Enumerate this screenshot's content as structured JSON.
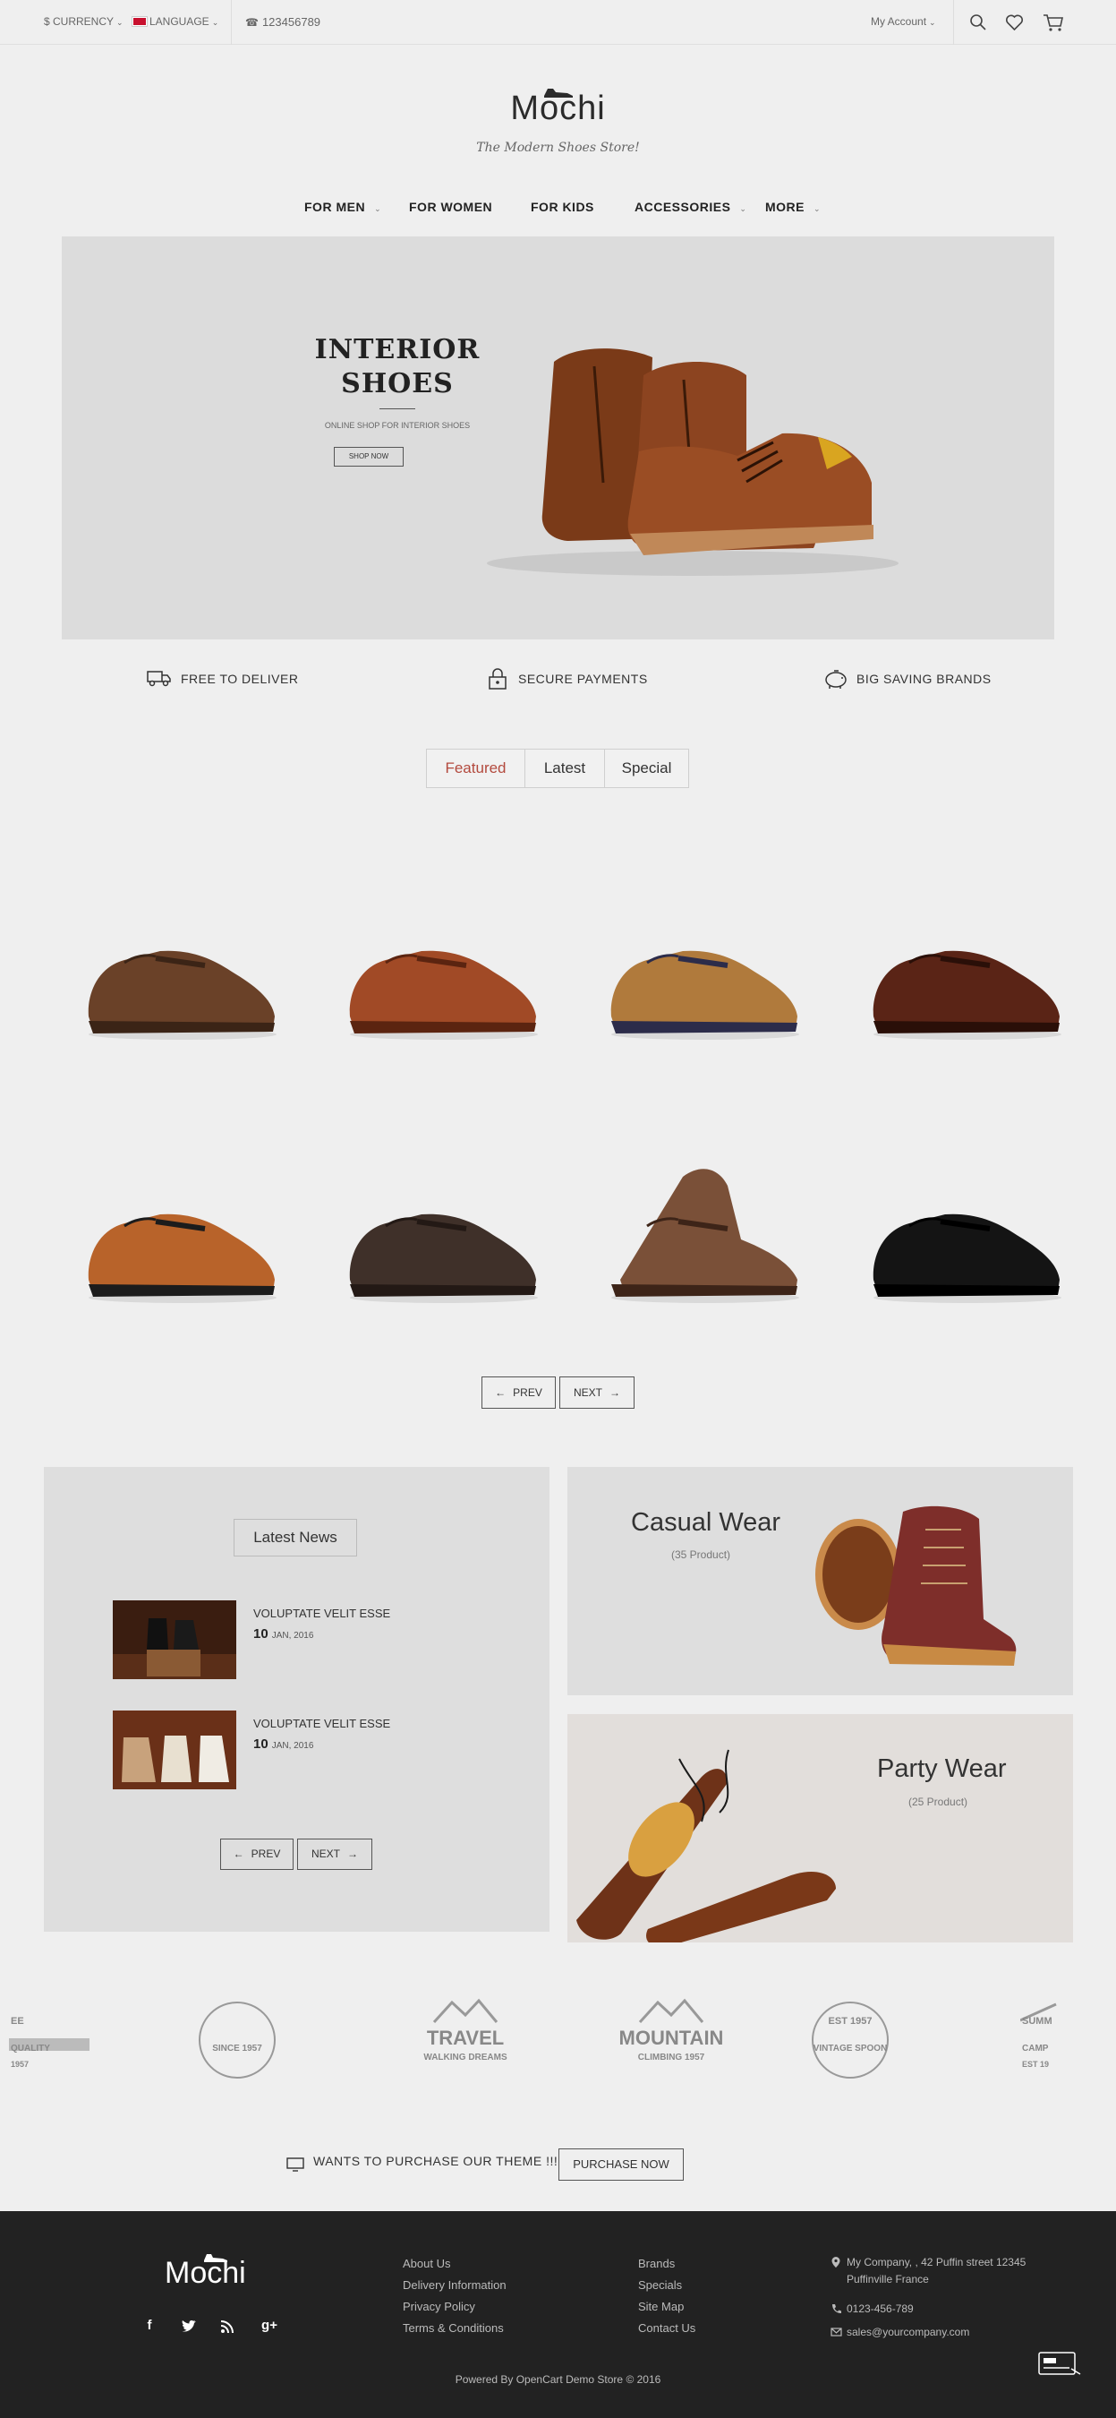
{
  "topbar": {
    "currency": "$ Currency",
    "language": "Language",
    "phone": "123456789",
    "account": "My Account"
  },
  "brand": {
    "name": "Mochi",
    "tagline": "The Modern Shoes Store!"
  },
  "nav": [
    {
      "label": "For Men",
      "has_dropdown": true
    },
    {
      "label": "For Women",
      "has_dropdown": false
    },
    {
      "label": "For Kids",
      "has_dropdown": false
    },
    {
      "label": "Accessories",
      "has_dropdown": true
    },
    {
      "label": "More",
      "has_dropdown": true
    }
  ],
  "banner": {
    "title_line1": "INTERIOR",
    "title_line2": "SHOES",
    "subtitle": "Online shop for interior shoes",
    "button": "Shop Now"
  },
  "features": [
    {
      "label": "Free to Deliver",
      "icon": "truck-icon"
    },
    {
      "label": "Secure Payments",
      "icon": "lock-icon"
    },
    {
      "label": "Big Saving Brands",
      "icon": "piggy-bank-icon"
    }
  ],
  "tabs": [
    {
      "label": "Featured",
      "active": true
    },
    {
      "label": "Latest",
      "active": false
    },
    {
      "label": "Special",
      "active": false
    }
  ],
  "products": [
    {
      "style": "monk-strap",
      "upper": "#6a4128",
      "accent": "#3b2416"
    },
    {
      "style": "brogue",
      "upper": "#a14a26",
      "accent": "#5b2410"
    },
    {
      "style": "wingtip",
      "upper": "#b07a3c",
      "accent": "#2c2c4a"
    },
    {
      "style": "cap-toe",
      "upper": "#5a2416",
      "accent": "#2a0f08"
    },
    {
      "style": "two-tone",
      "upper": "#b8632a",
      "accent": "#1c1c1c"
    },
    {
      "style": "suede",
      "upper": "#3f3029",
      "accent": "#231915"
    },
    {
      "style": "chukka",
      "upper": "#7a5038",
      "accent": "#3d2418"
    },
    {
      "style": "loafer",
      "upper": "#141414",
      "accent": "#000000"
    }
  ],
  "pager": {
    "prev": "Prev",
    "next": "Next"
  },
  "news": {
    "title": "Latest News",
    "items": [
      {
        "title": "Voluptate velit esse",
        "day": "10",
        "month_year": "Jan, 2016"
      },
      {
        "title": "Voluptate velit esse",
        "day": "10",
        "month_year": "Jan, 2016"
      }
    ],
    "prev": "Prev",
    "next": "Next"
  },
  "categories": [
    {
      "title": "Casual Wear",
      "count": "(35 Product)"
    },
    {
      "title": "Party Wear",
      "count": "(25 Product)"
    }
  ],
  "brands": [
    {
      "line1": "EE",
      "line2": "QUALITY",
      "line3": "1957"
    },
    {
      "line1": "",
      "line2": "SINCE 1957",
      "line3": ""
    },
    {
      "line1": "TRAVEL",
      "line2": "WALKING DREAMS",
      "line3": ""
    },
    {
      "line1": "MOUNTAIN",
      "line2": "CLIMBING 1957",
      "line3": ""
    },
    {
      "line1": "EST 1957",
      "line2": "VINTAGE SPOON",
      "line3": ""
    },
    {
      "line1": "SUMM",
      "line2": "CAMP",
      "line3": "EST 19"
    }
  ],
  "purchase": {
    "text": "Wants to purchase our theme !!!",
    "button": "Purchase Now"
  },
  "footer": {
    "logo": "Mochi",
    "links_col1": [
      "About Us",
      "Delivery Information",
      "Privacy Policy",
      "Terms & Conditions"
    ],
    "links_col2": [
      "Brands",
      "Specials",
      "Site Map",
      "Contact Us"
    ],
    "address_line1": "My Company, , 42 Puffin street 12345",
    "address_line2": "Puffinville France",
    "phone": "0123-456-789",
    "email": "sales@yourcompany.com",
    "copyright": "Powered By OpenCart Demo Store © 2016"
  },
  "colors": {
    "accent": "#b34a3e",
    "page_bg": "#efefef",
    "footer_bg": "#222222"
  }
}
